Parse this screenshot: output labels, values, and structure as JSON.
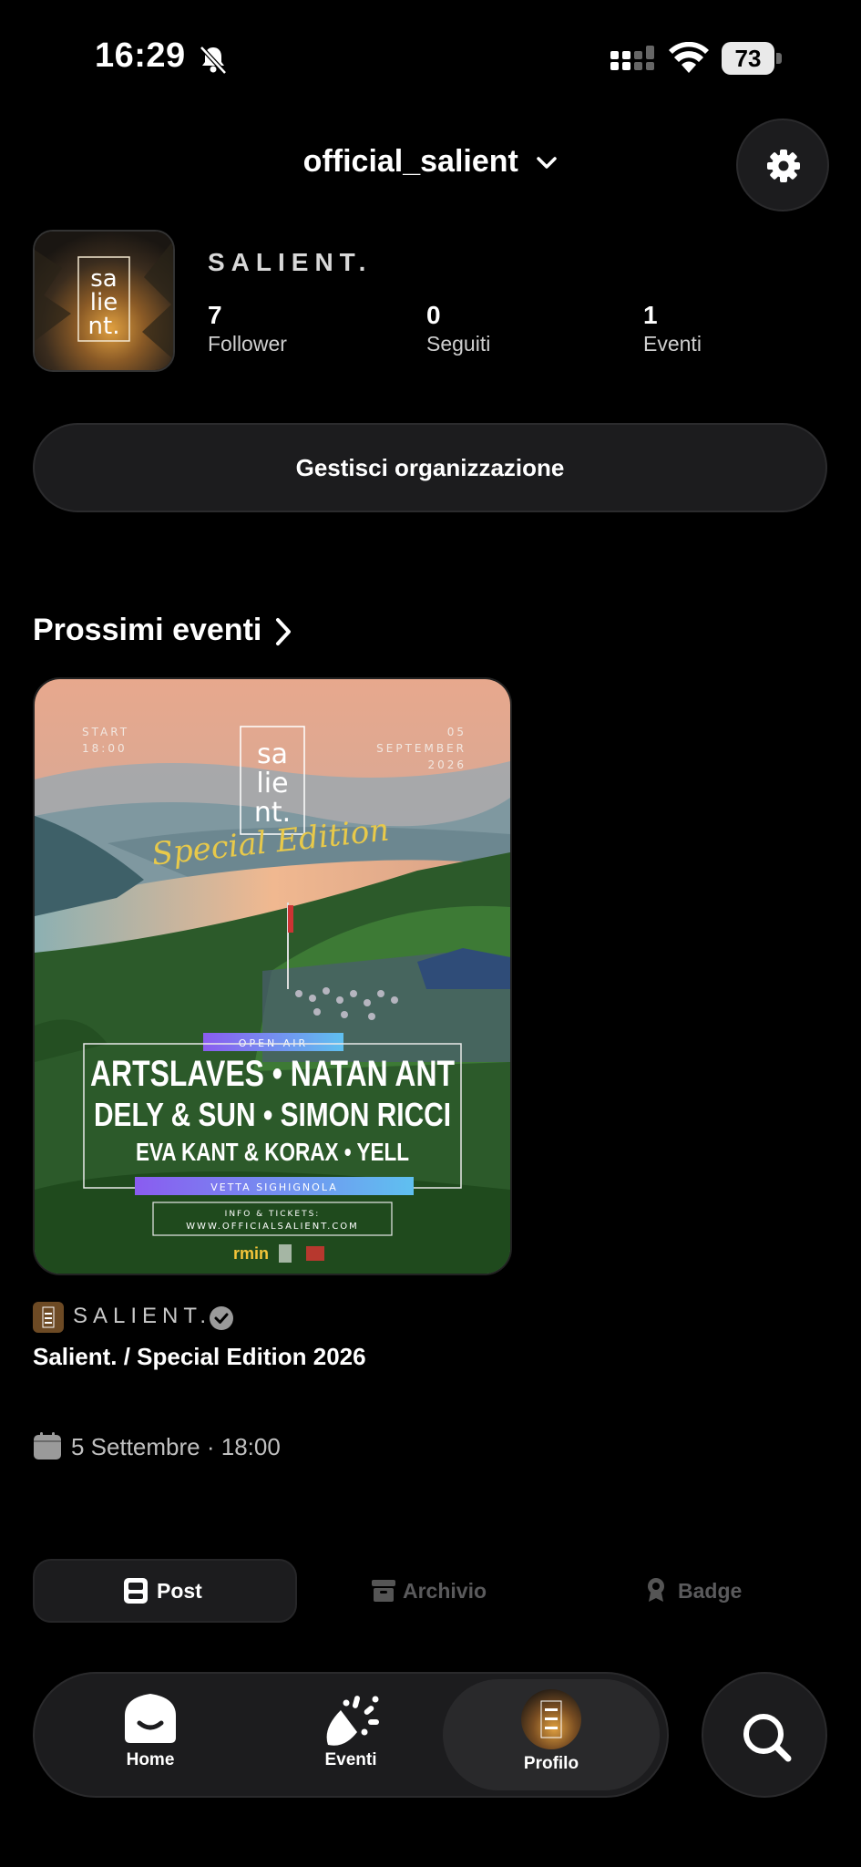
{
  "status_bar": {
    "time": "16:29",
    "battery": "73"
  },
  "header": {
    "account_name": "official_salient"
  },
  "profile": {
    "org_name": "SALIENT.",
    "avatar_text": [
      "sa",
      "lie",
      "nt."
    ],
    "stats": [
      {
        "value": "7",
        "label": "Follower"
      },
      {
        "value": "0",
        "label": "Seguiti"
      },
      {
        "value": "1",
        "label": "Eventi"
      }
    ],
    "manage_button": "Gestisci organizzazione"
  },
  "upcoming": {
    "title": "Prossimi eventi",
    "event": {
      "poster": {
        "start_label": "START",
        "start_time": "18:00",
        "date_day": "05",
        "date_month": "SEPTEMBER",
        "date_year": "2026",
        "logo": [
          "sa",
          "lie",
          "nt."
        ],
        "edition": "Special Edition",
        "open_air": "OPEN AIR",
        "lineup": [
          "ARTSLAVES • NATAN ANT",
          "DELY & SUN • SIMON RICCI",
          "EVA KANT & KORAX • YELL"
        ],
        "venue": "VETTA SIGHIGNOLA",
        "info_label": "INFO & TICKETS:",
        "website": "WWW.OFFICIALSALIENT.COM",
        "sponsor": "rmin"
      },
      "organizer": "SALIENT.",
      "title": "Salient. / Special Edition 2026",
      "datetime": "5 Settembre · 18:00"
    }
  },
  "tabs": [
    {
      "label": "Post",
      "active": true
    },
    {
      "label": "Archivio",
      "active": false
    },
    {
      "label": "Badge",
      "active": false
    }
  ],
  "nav": [
    {
      "label": "Home"
    },
    {
      "label": "Eventi"
    },
    {
      "label": "Profilo",
      "active": true
    }
  ],
  "colors": {
    "background": "#000000",
    "surface": "#1c1c1e",
    "text": "#ffffff",
    "muted": "#8e8e93"
  }
}
